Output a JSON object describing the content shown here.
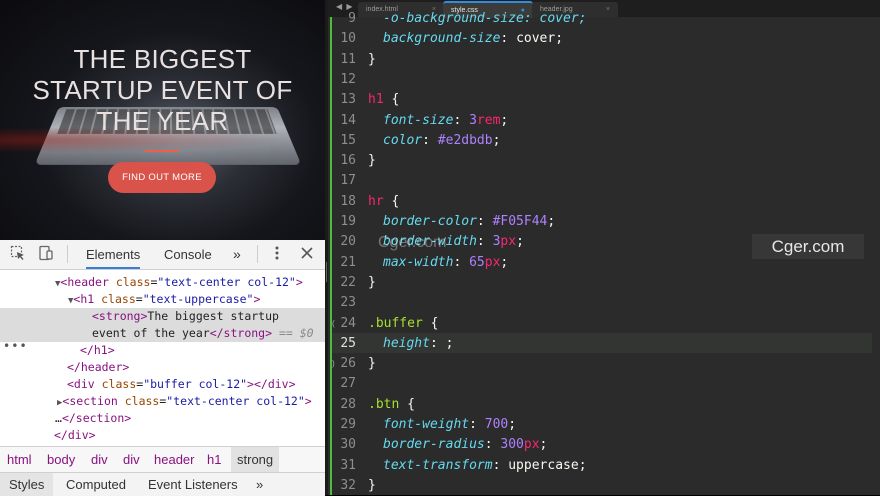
{
  "preview": {
    "title_line1": "THE BIGGEST",
    "title_line2": "STARTUP EVENT OF",
    "title_line3": "THE YEAR",
    "cta_label": "FIND OUT MORE",
    "accent_color": "#F05F44"
  },
  "devtools": {
    "toolbar": {
      "inspect_icon": "cursor-select-icon",
      "device_icon": "device-toggle-icon",
      "tabs": [
        "Elements",
        "Console"
      ],
      "more_tabs": "»",
      "menu_icon": "vertical-dots-icon",
      "close_icon": "close-icon"
    },
    "dom": {
      "l1_tag_open": "<header ",
      "l1_attr": "class",
      "l1_val": "\"text-center col-12\"",
      "l1_close": ">",
      "l2_tag_open": "<h1 ",
      "l2_attr": "class",
      "l2_val": "\"text-uppercase\"",
      "l2_close": ">",
      "l3_tag_open": "<strong>",
      "l3_text": "The biggest startup",
      "l4_text": "event of the year",
      "l4_tag_close": "</strong>",
      "l4_eq": " == $0",
      "l5": "</h1>",
      "l6": "</header>",
      "l7_tag_open": "<div ",
      "l7_attr": "class",
      "l7_val": "\"buffer col-12\"",
      "l7_close": "></div>",
      "l8_tag_open": "<section ",
      "l8_attr": "class",
      "l8_val": "\"text-center col-12\"",
      "l8_close": ">",
      "l9_prefix": "…",
      "l9": "</section>",
      "l10": "</div>",
      "dots": "•••"
    },
    "breadcrumbs": [
      "html",
      "body",
      "div",
      "div",
      "header",
      "h1",
      "strong"
    ],
    "panel_tabs": [
      "Styles",
      "Computed",
      "Event Listeners",
      "»"
    ]
  },
  "editor": {
    "nav": "◀ ▶",
    "tabs": [
      {
        "label": "index.html",
        "close": "×"
      },
      {
        "label": "style.css",
        "close": "●"
      },
      {
        "label": "header.jpg",
        "close": "×"
      }
    ],
    "lines": [
      {
        "n": "9",
        "text": "-o-background-size: cover;"
      },
      {
        "n": "10",
        "prop": "background-size",
        "value": "cover"
      },
      {
        "n": "11",
        "text": "}"
      },
      {
        "n": "12",
        "text": ""
      },
      {
        "n": "13",
        "selector": "h1",
        "brace": " {"
      },
      {
        "n": "14",
        "prop": "font-size",
        "num": "3",
        "unit": "rem"
      },
      {
        "n": "15",
        "prop": "color",
        "value": "#e2dbdb"
      },
      {
        "n": "16",
        "text": "}"
      },
      {
        "n": "17",
        "text": ""
      },
      {
        "n": "18",
        "selector": "hr",
        "brace": " {"
      },
      {
        "n": "19",
        "prop": "border-color",
        "value": "#F05F44"
      },
      {
        "n": "20",
        "prop": "border-width",
        "num": "3",
        "unit": "px"
      },
      {
        "n": "21",
        "prop": "max-width",
        "num": "65",
        "unit": "px"
      },
      {
        "n": "22",
        "text": "}"
      },
      {
        "n": "23",
        "text": ""
      },
      {
        "n": "24",
        "selector": ".buffer",
        "brace": " {"
      },
      {
        "n": "25",
        "prop": "height",
        "value": ""
      },
      {
        "n": "26",
        "text": "}"
      },
      {
        "n": "27",
        "text": ""
      },
      {
        "n": "28",
        "selector": ".btn",
        "brace": " {"
      },
      {
        "n": "29",
        "prop": "font-weight",
        "value": "700"
      },
      {
        "n": "30",
        "prop": "border-radius",
        "num": "300",
        "unit": "px"
      },
      {
        "n": "31",
        "prop": "text-transform",
        "value": "uppercase"
      },
      {
        "n": "32",
        "text": "}"
      }
    ],
    "watermark": "Cger.com",
    "watermark_overlay": "Cger.com",
    "colors": {
      "selector": "#f92672",
      "property": "#66d9ef",
      "number": "#ae81ff",
      "gutter_modified": "#4cbe3a"
    }
  }
}
